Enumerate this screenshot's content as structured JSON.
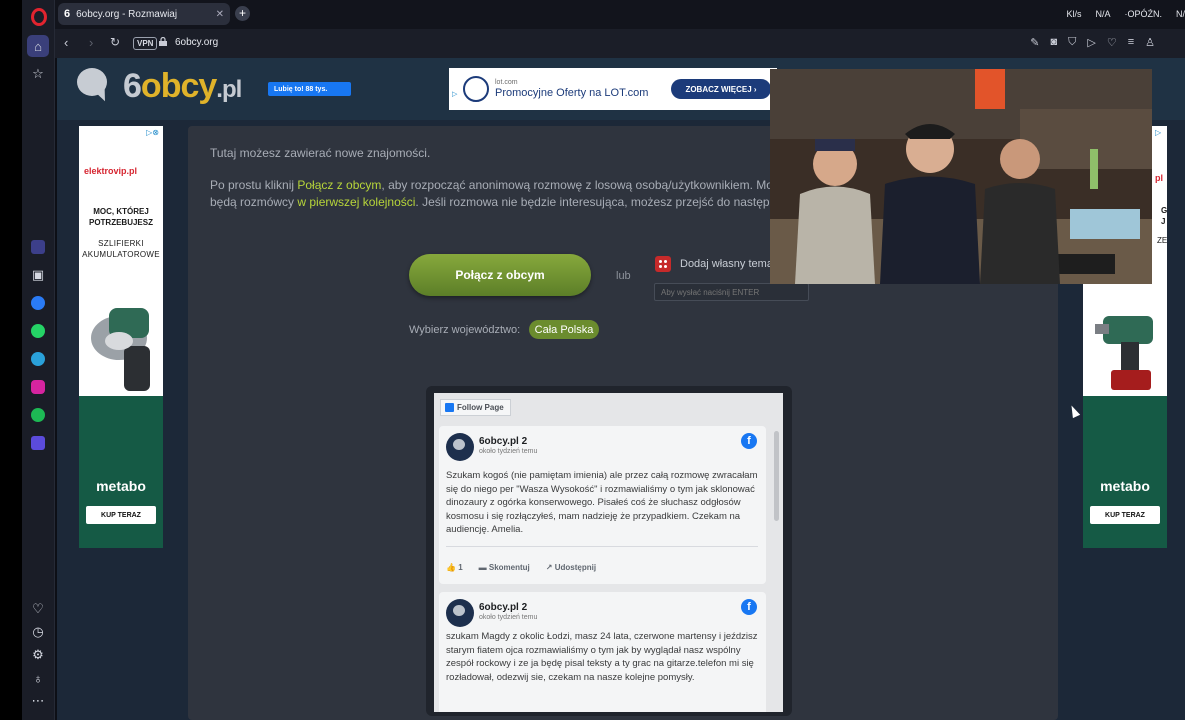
{
  "browser": {
    "tab_title": "6obcy.org - Rozmawiaj",
    "tab_favicon": "6",
    "url": "6obcy.org",
    "vpn_label": "VPN",
    "tray": [
      "Kl/s",
      "N/A",
      "·OPÓŹN.",
      "N/"
    ]
  },
  "site": {
    "logo_6": "6",
    "logo_obcy": "obcy",
    "logo_pl": ".pl",
    "fb_like": "Lubię to! 88 tys.",
    "top_ad": {
      "small": "lot.com",
      "text": "Promocyjne Oferty na LOT.com",
      "button": "ZOBACZ WIĘCEJ ›"
    },
    "left_ad": {
      "store": "elektrovip.pl",
      "headline": "MOC, KTÓREJ POTRZEBUJESZ",
      "sub": "SZLIFIERKI AKUMULATOROWE",
      "brand": "metabo",
      "button": "KUP TERAZ"
    },
    "right_ad": {
      "brand": "metabo",
      "button": "KUP TERAZ",
      "fragments": [
        "pl",
        "G",
        "J",
        "ZE"
      ]
    },
    "intro": "Tutaj możesz zawierać nowe znajomości.",
    "para": {
      "t1": "Po prostu kliknij ",
      "link1": "Połącz z obcym",
      "t2": ", aby rozpocząć anonimową rozmowę z losową osobą/użytkownikiem. Możes",
      "t3": "będą rozmówcy ",
      "link2": "w pierwszej kolejności",
      "t4": ". Jeśli rozmowa nie będzie interesująca, możesz przejść do następnej."
    },
    "connect_button": "Połącz z obcym",
    "or_label": "lub",
    "add_topic": "Dodaj własny temat",
    "topic_placeholder": "Aby wysłać naciśnij ENTER",
    "voivodeship_label": "Wybierz województwo:",
    "voivodeship_value": "Cała Polska"
  },
  "fb_widget": {
    "follow": "Follow Page",
    "posts": [
      {
        "name": "6obcy.pl 2",
        "time": "około tydzień temu",
        "text": "Szukam kogoś (nie pamiętam imienia) ale przez całą rozmowę zwracałam się do niego per \"Wasza Wysokość\" i rozmawialiśmy o tym jak sklonować dinozaury z ogórka konserwowego. Pisałeś coś że słuchasz odgłosów kosmosu i się rozłączyłeś, mam nadzieję że przypadkiem. Czekam na audiencję. Amelia.",
        "likes": "1",
        "comment": "Skomentuj",
        "share": "Udostępnij"
      },
      {
        "name": "6obcy.pl 2",
        "time": "około tydzień temu",
        "text": "szukam Magdy z okolic Łodzi, masz 24 lata, czerwone martensy i jeździsz starym fiatem ojca rozmawialiśmy o tym jak by wyglądał nasz wspólny zespół rockowy i ze ja będę pisal teksty a ty grac na gitarze.telefon mi się rozładował, odezwij sie, czekam na nasze kolejne pomysły."
      }
    ]
  },
  "colors": {
    "accent_green": "#b7d53a",
    "button_green": "#6b8c2e",
    "logo_gold": "#e0b32a",
    "facebook_blue": "#1877f2",
    "opera_red": "#e2242f"
  }
}
